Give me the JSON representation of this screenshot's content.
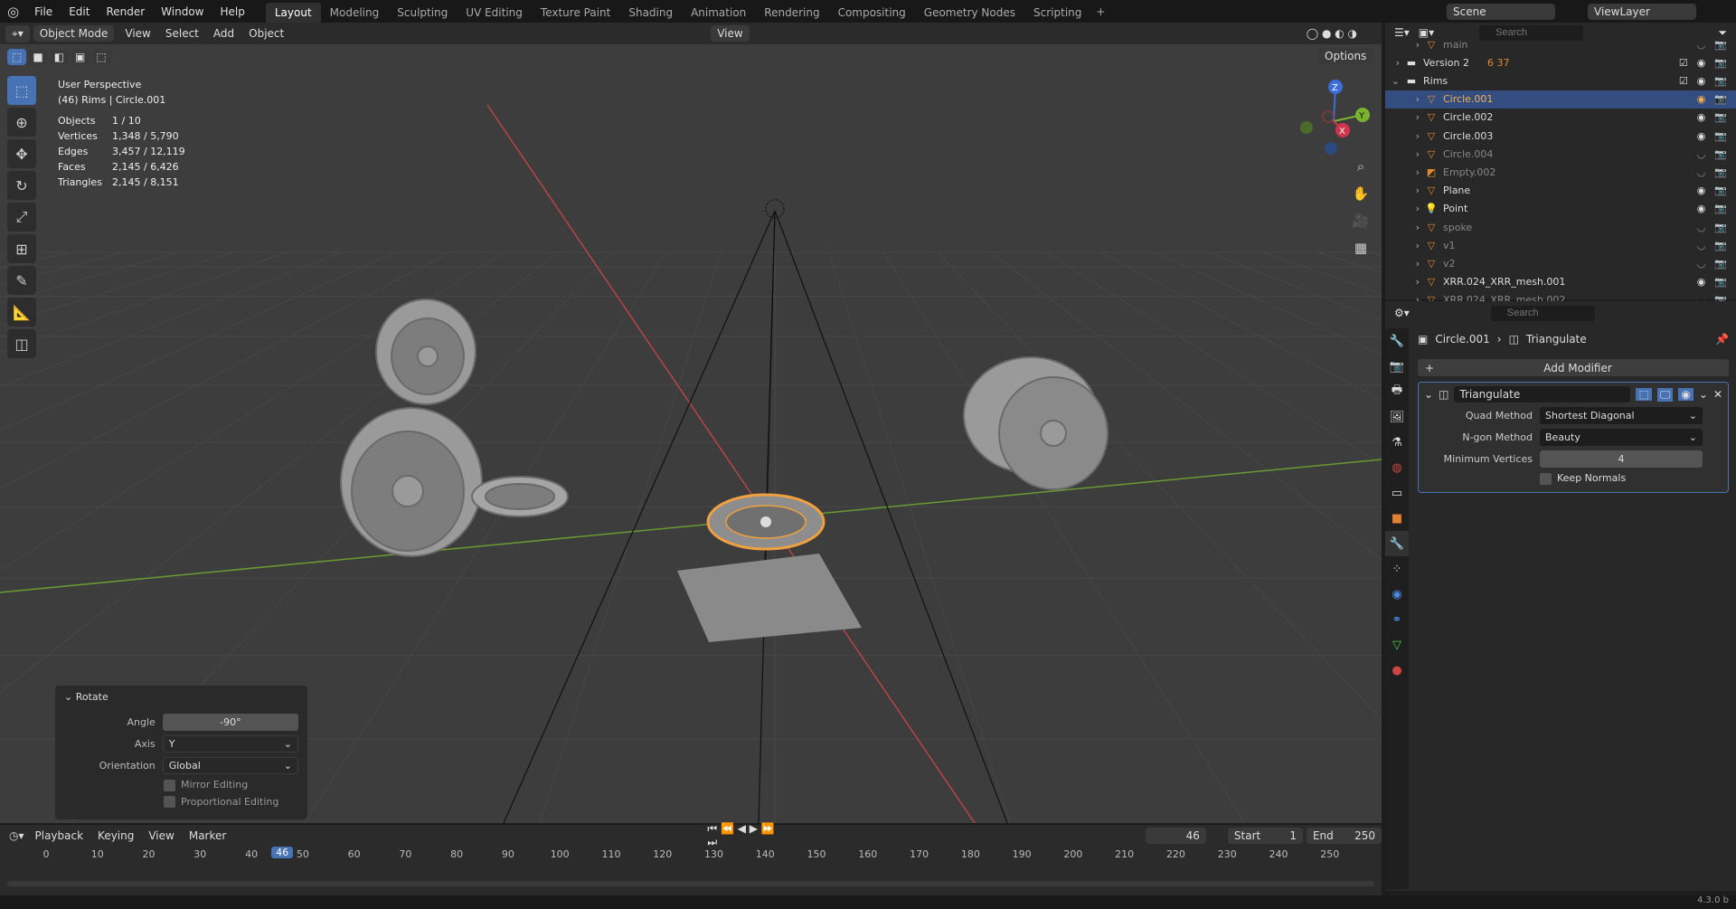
{
  "menu": [
    "File",
    "Edit",
    "Render",
    "Window",
    "Help"
  ],
  "workspaces": [
    "Layout",
    "Modeling",
    "Sculpting",
    "UV Editing",
    "Texture Paint",
    "Shading",
    "Animation",
    "Rendering",
    "Compositing",
    "Geometry Nodes",
    "Scripting"
  ],
  "active_workspace": "Layout",
  "scene": "Scene",
  "view_layer": "ViewLayer",
  "viewport_header": {
    "mode": "Object Mode",
    "items": [
      "View",
      "Select",
      "Add",
      "Object"
    ],
    "transform_orientation": "View",
    "options": "Options"
  },
  "overlay": {
    "perspective": "User Perspective",
    "context": "(46) Rims | Circle.001",
    "stats": [
      {
        "label": "Objects",
        "value": "1 / 10"
      },
      {
        "label": "Vertices",
        "value": "1,348 / 5,790"
      },
      {
        "label": "Edges",
        "value": "3,457 / 12,119"
      },
      {
        "label": "Faces",
        "value": "2,145 / 6,426"
      },
      {
        "label": "Triangles",
        "value": "2,145 / 8,151"
      }
    ]
  },
  "gizmo": {
    "z": "Z",
    "y": "Y",
    "x": "X"
  },
  "rotate_panel": {
    "title": "Rotate",
    "angle_label": "Angle",
    "angle": "-90°",
    "axis_label": "Axis",
    "axis": "Y",
    "orientation_label": "Orientation",
    "orientation": "Global",
    "mirror": "Mirror Editing",
    "proportional": "Proportional Editing"
  },
  "timeline": {
    "menus": [
      "Playback",
      "Keying",
      "View",
      "Marker"
    ],
    "current_frame": "46",
    "start_label": "Start",
    "start": "1",
    "end_label": "End",
    "end": "250",
    "ticks": [
      "0",
      "10",
      "20",
      "30",
      "40",
      "50",
      "60",
      "70",
      "80",
      "90",
      "100",
      "110",
      "120",
      "130",
      "140",
      "150",
      "160",
      "170",
      "180",
      "190",
      "200",
      "210",
      "220",
      "230",
      "240",
      "250"
    ]
  },
  "outliner": {
    "search_placeholder": "Search",
    "rows": [
      {
        "name": "main",
        "indent": 2,
        "dim": true,
        "type": "mesh"
      },
      {
        "name": "Version 2",
        "indent": 1,
        "type": "collection",
        "badges": "6 37"
      },
      {
        "name": "Rims",
        "indent": 1,
        "type": "collection",
        "open": true
      },
      {
        "name": "Circle.001",
        "indent": 2,
        "type": "mesh",
        "selected": true
      },
      {
        "name": "Circle.002",
        "indent": 2,
        "type": "mesh"
      },
      {
        "name": "Circle.003",
        "indent": 2,
        "type": "mesh"
      },
      {
        "name": "Circle.004",
        "indent": 2,
        "type": "mesh",
        "dim": true
      },
      {
        "name": "Empty.002",
        "indent": 2,
        "type": "empty",
        "dim": true
      },
      {
        "name": "Plane",
        "indent": 2,
        "type": "mesh"
      },
      {
        "name": "Point",
        "indent": 2,
        "type": "light"
      },
      {
        "name": "spoke",
        "indent": 2,
        "type": "mesh",
        "dim": true
      },
      {
        "name": "v1",
        "indent": 2,
        "type": "mesh",
        "dim": true
      },
      {
        "name": "v2",
        "indent": 2,
        "type": "mesh",
        "dim": true
      },
      {
        "name": "XRR.024_XRR_mesh.001",
        "indent": 2,
        "type": "mesh"
      },
      {
        "name": "XRR.024_XRR_mesh.002",
        "indent": 2,
        "type": "mesh",
        "dim": true
      }
    ]
  },
  "properties": {
    "search_placeholder": "Search",
    "breadcrumb_object": "Circle.001",
    "breadcrumb_modifier": "Triangulate",
    "add_modifier": "Add Modifier",
    "modifier": {
      "name": "Triangulate",
      "quad_label": "Quad Method",
      "quad": "Shortest Diagonal",
      "ngon_label": "N-gon Method",
      "ngon": "Beauty",
      "minv_label": "Minimum Vertices",
      "minv": "4",
      "keep_normals": "Keep Normals"
    }
  },
  "version": "4.3.0 b",
  "colors": {
    "accent": "#4772b3",
    "selected_orange": "#f0a040",
    "axis_x": "#c84040",
    "axis_y": "#6a9a30"
  }
}
